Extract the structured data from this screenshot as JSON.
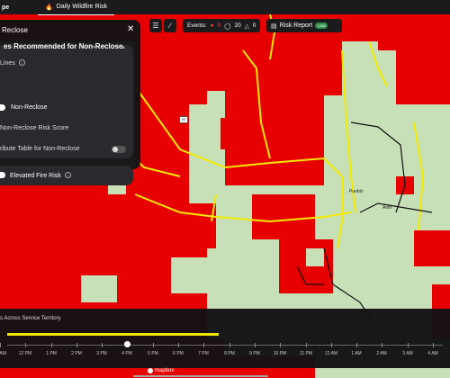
{
  "app": {
    "brand": "pe",
    "tab_label": "Daily Wildfire Risk",
    "tab_icon": "flame-icon"
  },
  "panel": {
    "title": "Reclose",
    "close_glyph": "✕",
    "section_title": "es Recommended for Non-Reclose",
    "lines_label": "Lines",
    "radio_label": "Non-Reclose",
    "score_label": "Non-Reclose Risk Score",
    "table_label": "ribute Table for Non-Reclose",
    "table_toggle_on": false,
    "elevated_label": "Elevated Fire Risk"
  },
  "toolbar": {
    "layers_icon": "layers-icon",
    "measure_icon": "ruler-icon",
    "events_label": "Events:",
    "events_fire_count": "0",
    "events_alert_count": "20",
    "events_other_count": "0",
    "report_label": "Risk Report",
    "report_badge": "Low"
  },
  "timeline": {
    "title": "s Across Service Territory",
    "current_label": "4 PM",
    "ticks": [
      "11 AM",
      "12 PM",
      "1 PM",
      "2 PM",
      "3 PM",
      "4 PM",
      "5 PM",
      "6 PM",
      "7 PM",
      "8 PM",
      "9 PM",
      "10 PM",
      "11 PM",
      "12 AM",
      "1 AM",
      "2 AM",
      "3 AM",
      "4 AM"
    ],
    "fill_fraction": 0.49
  },
  "map": {
    "place_labels": [
      "Pueblo",
      "Ante"
    ],
    "route_label": "64",
    "attribution": "mapbox"
  },
  "colors": {
    "risk_red": "#e60000",
    "line_yellow": "#f2ea00",
    "base_green": "#c8e0b8",
    "panel_bg": "#121214",
    "badge_green": "#2f8f4a"
  }
}
